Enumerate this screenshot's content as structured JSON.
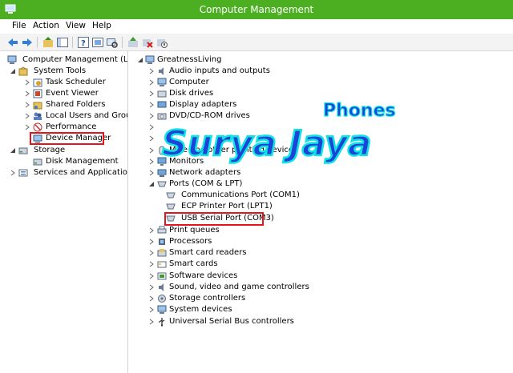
{
  "window": {
    "title": "Computer Management"
  },
  "menu": [
    "File",
    "Action",
    "View",
    "Help"
  ],
  "toolbar": {
    "icons": [
      "back-arrow-icon",
      "forward-arrow-icon",
      "up-folder-icon",
      "show-hide-tree-icon",
      "help-icon",
      "properties-icon",
      "scan-hardware-icon",
      "update-driver-icon",
      "uninstall-icon",
      "disable-device-icon"
    ]
  },
  "left_tree": {
    "root": "Computer Management (Local",
    "system_tools": "System Tools",
    "items": [
      "Task Scheduler",
      "Event Viewer",
      "Shared Folders",
      "Local Users and Groups",
      "Performance",
      "Device Manager"
    ],
    "storage": "Storage",
    "disk_management": "Disk Management",
    "services": "Services and Applications"
  },
  "device_tree": {
    "computer_name": "GreatnessLiving",
    "categories_top": [
      "Audio inputs and outputs",
      "Computer",
      "Disk drives",
      "Display adapters",
      "DVD/CD-ROM drives"
    ],
    "obscured_row": "Mice and other pointing devices",
    "categories_mid": [
      "Monitors",
      "Network adapters"
    ],
    "ports": "Ports (COM & LPT)",
    "port_items": [
      "Communications Port (COM1)",
      "ECP Printer Port (LPT1)",
      "USB Serial Port (COM3)"
    ],
    "categories_bottom": [
      "Print queues",
      "Processors",
      "Smart card readers",
      "Smart cards",
      "Software devices",
      "Sound, video and game controllers",
      "Storage controllers",
      "System devices",
      "Universal Serial Bus controllers"
    ]
  },
  "watermark": {
    "line1": "Phones",
    "line2": "Surya Jaya"
  },
  "colors": {
    "titlebar": "#4caf22",
    "highlight": "#e3151b",
    "watermark_fill": "#1a45d8",
    "watermark_outline": "#11e3e3"
  }
}
